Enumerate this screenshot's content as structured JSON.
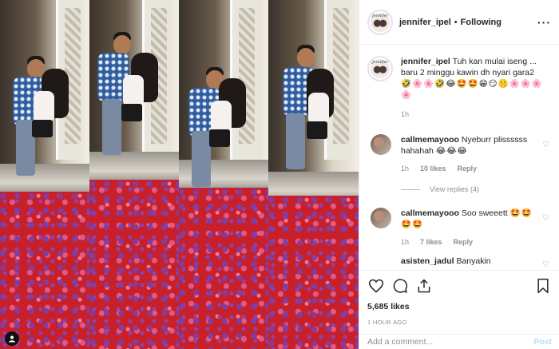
{
  "header": {
    "username": "jennifer_ipel",
    "separator": "•",
    "follow_status": "Following",
    "more": "···",
    "avatar_text": "Jennifer"
  },
  "caption": {
    "username": "jennifer_ipel",
    "text": "Tuh kan mulai iseng ... baru 2 minggu kawin dh nyari gara2",
    "emojis": "🤣🌸🌸🤣😂🤩🤩😁😏🤫🌸🌸🌸🌸",
    "time": "1h"
  },
  "comments": [
    {
      "username": "callmemayooo",
      "text": "Nyeburr plissssss hahahah",
      "emojis": "😂😂😂",
      "time": "1h",
      "likes": "10 likes",
      "reply": "Reply",
      "view_replies": "View replies (4)"
    },
    {
      "username": "callmemayooo",
      "text": "Soo sweeett",
      "emojis": "🤩🤩🤩🤩",
      "time": "1h",
      "likes": "7 likes",
      "reply": "Reply"
    },
    {
      "username": "asisten_jadul",
      "text": "Banyakin"
    }
  ],
  "actions": {
    "likes": "5,685 likes",
    "posted": "1 HOUR AGO"
  },
  "add_comment": {
    "placeholder": "Add a comment...",
    "post_label": "Post"
  },
  "colors": {
    "link_blue": "#b2dffc",
    "muted": "#8e8e8e",
    "text": "#262626",
    "petal_red": "#c7202b"
  },
  "icons": [
    "heart-icon",
    "comment-icon",
    "share-icon",
    "bookmark-icon",
    "more-icon"
  ]
}
